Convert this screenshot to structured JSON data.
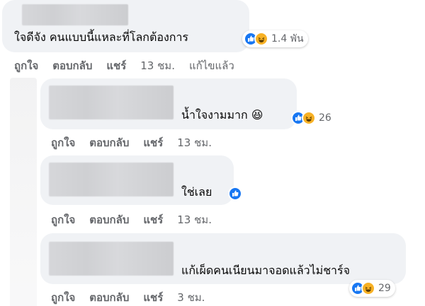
{
  "comments": [
    {
      "text": "ใจดีจัง คนแบบนี้แหละที่โลกต้องการ",
      "reaction_count": "1.4 พัน",
      "reaction_icons": [
        "like-icon",
        "haha-icon"
      ],
      "actions": {
        "like": "ถูกใจ",
        "reply": "ตอบกลับ",
        "share": "แชร์",
        "time": "13 ชม.",
        "edited": "แก้ไขแล้ว"
      }
    },
    {
      "text": "น้ำใจงามมาก 😆",
      "reaction_count": "26",
      "reaction_icons": [
        "like-icon",
        "haha-icon"
      ],
      "actions": {
        "like": "ถูกใจ",
        "reply": "ตอบกลับ",
        "share": "แชร์",
        "time": "13 ชม."
      }
    },
    {
      "text": "ใช่เลย",
      "reaction_count": "",
      "reaction_icons": [
        "like-icon"
      ],
      "actions": {
        "like": "ถูกใจ",
        "reply": "ตอบกลับ",
        "share": "แชร์",
        "time": "13 ชม."
      }
    },
    {
      "text": "แก้เผ็ดคนเนียนมาจอดแล้วไม่ชาร์จ",
      "reaction_count": "29",
      "reaction_icons": [
        "like-icon",
        "haha-icon"
      ],
      "actions": {
        "like": "ถูกใจ",
        "reply": "ตอบกลับ",
        "share": "แชร์",
        "time": "3 ชม."
      }
    }
  ],
  "colors": {
    "bubble": "#f0f2f5",
    "like": "#1877f2",
    "haha": "#f7b125",
    "muted": "#65676b"
  }
}
